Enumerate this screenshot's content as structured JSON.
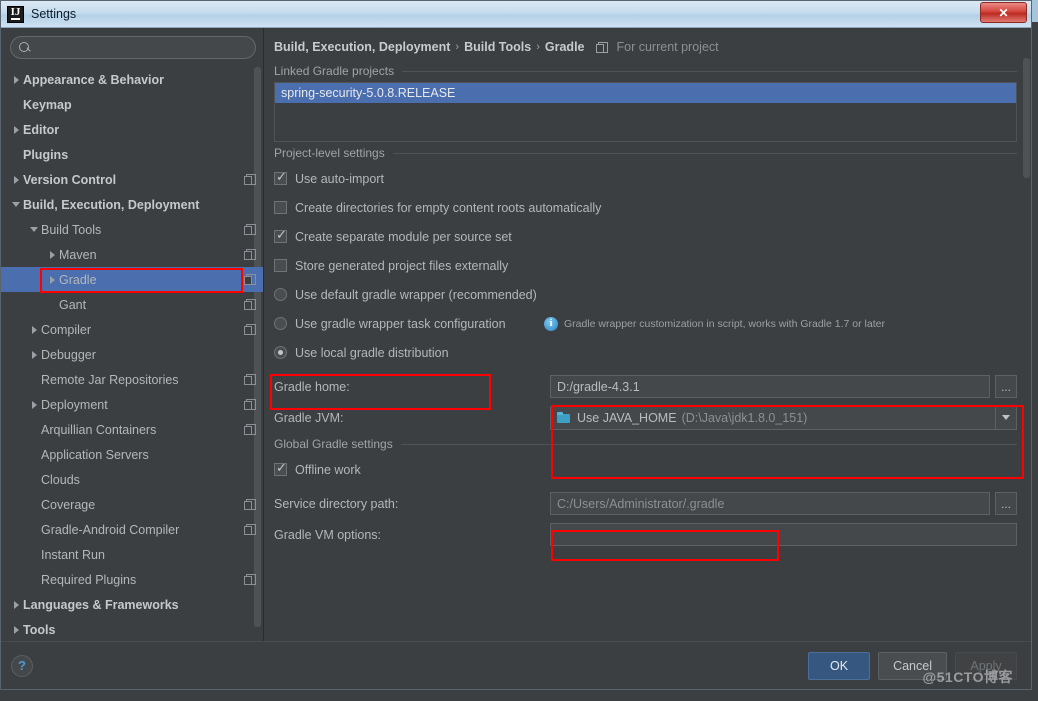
{
  "window": {
    "title": "Settings",
    "logo_text": "IJ",
    "close_label": "✕"
  },
  "search": {
    "value": "",
    "placeholder": ""
  },
  "sidebar": {
    "items": [
      {
        "label": "Appearance & Behavior",
        "indent": 0,
        "arrow": "right",
        "bold": true,
        "copy": false,
        "selected": false
      },
      {
        "label": "Keymap",
        "indent": 0,
        "arrow": "none",
        "bold": true,
        "copy": false,
        "selected": false
      },
      {
        "label": "Editor",
        "indent": 0,
        "arrow": "right",
        "bold": true,
        "copy": false,
        "selected": false
      },
      {
        "label": "Plugins",
        "indent": 0,
        "arrow": "none",
        "bold": true,
        "copy": false,
        "selected": false
      },
      {
        "label": "Version Control",
        "indent": 0,
        "arrow": "right",
        "bold": true,
        "copy": true,
        "selected": false
      },
      {
        "label": "Build, Execution, Deployment",
        "indent": 0,
        "arrow": "down",
        "bold": true,
        "copy": false,
        "selected": false
      },
      {
        "label": "Build Tools",
        "indent": 1,
        "arrow": "down",
        "bold": false,
        "copy": true,
        "selected": false
      },
      {
        "label": "Maven",
        "indent": 2,
        "arrow": "right",
        "bold": false,
        "copy": true,
        "selected": false
      },
      {
        "label": "Gradle",
        "indent": 2,
        "arrow": "right",
        "bold": false,
        "copy": true,
        "selected": true
      },
      {
        "label": "Gant",
        "indent": 2,
        "arrow": "none",
        "bold": false,
        "copy": true,
        "selected": false
      },
      {
        "label": "Compiler",
        "indent": 1,
        "arrow": "right",
        "bold": false,
        "copy": true,
        "selected": false
      },
      {
        "label": "Debugger",
        "indent": 1,
        "arrow": "right",
        "bold": false,
        "copy": false,
        "selected": false
      },
      {
        "label": "Remote Jar Repositories",
        "indent": 1,
        "arrow": "none",
        "bold": false,
        "copy": true,
        "selected": false
      },
      {
        "label": "Deployment",
        "indent": 1,
        "arrow": "right",
        "bold": false,
        "copy": true,
        "selected": false
      },
      {
        "label": "Arquillian Containers",
        "indent": 1,
        "arrow": "none",
        "bold": false,
        "copy": true,
        "selected": false
      },
      {
        "label": "Application Servers",
        "indent": 1,
        "arrow": "none",
        "bold": false,
        "copy": false,
        "selected": false
      },
      {
        "label": "Clouds",
        "indent": 1,
        "arrow": "none",
        "bold": false,
        "copy": false,
        "selected": false
      },
      {
        "label": "Coverage",
        "indent": 1,
        "arrow": "none",
        "bold": false,
        "copy": true,
        "selected": false
      },
      {
        "label": "Gradle-Android Compiler",
        "indent": 1,
        "arrow": "none",
        "bold": false,
        "copy": true,
        "selected": false
      },
      {
        "label": "Instant Run",
        "indent": 1,
        "arrow": "none",
        "bold": false,
        "copy": false,
        "selected": false
      },
      {
        "label": "Required Plugins",
        "indent": 1,
        "arrow": "none",
        "bold": false,
        "copy": true,
        "selected": false
      },
      {
        "label": "Languages & Frameworks",
        "indent": 0,
        "arrow": "right",
        "bold": true,
        "copy": false,
        "selected": false
      },
      {
        "label": "Tools",
        "indent": 0,
        "arrow": "right",
        "bold": true,
        "copy": false,
        "selected": false
      }
    ]
  },
  "breadcrumb": {
    "part1": "Build, Execution, Deployment",
    "sep1": "›",
    "part2": "Build Tools",
    "sep2": "›",
    "part3": "Gradle",
    "note": "For current project"
  },
  "linked_projects": {
    "group_title": "Linked Gradle projects",
    "items": [
      {
        "label": "spring-security-5.0.8.RELEASE",
        "selected": true
      }
    ]
  },
  "project_level": {
    "group_title": "Project-level settings",
    "checkboxes": [
      {
        "label": "Use auto-import",
        "checked": true
      },
      {
        "label": "Create directories for empty content roots automatically",
        "checked": false
      },
      {
        "label": "Create separate module per source set",
        "checked": true
      },
      {
        "label": "Store generated project files externally",
        "checked": false
      }
    ],
    "radios": [
      {
        "label": "Use default gradle wrapper (recommended)",
        "checked": false
      },
      {
        "label": "Use gradle wrapper task configuration",
        "checked": false
      },
      {
        "label": "Use local gradle distribution",
        "checked": true
      }
    ],
    "wrapper_note": "Gradle wrapper customization in script, works with Gradle 1.7 or later",
    "gradle_home": {
      "label": "Gradle home:",
      "value": "D:/gradle-4.3.1",
      "browse_label": "..."
    },
    "gradle_jvm": {
      "label": "Gradle JVM:",
      "value": "Use JAVA_HOME",
      "value_detail": "(D:\\Java\\jdk1.8.0_151)"
    }
  },
  "global_settings": {
    "group_title": "Global Gradle settings",
    "offline": {
      "label": "Offline work",
      "checked": true
    },
    "service_dir": {
      "label": "Service directory path:",
      "value": "C:/Users/Administrator/.gradle",
      "browse_label": "..."
    },
    "vm_options": {
      "label": "Gradle VM options:",
      "value": ""
    }
  },
  "footer": {
    "help_label": "?",
    "ok_label": "OK",
    "cancel_label": "Cancel",
    "apply_label": "Apply",
    "watermark": "@51CTO博客"
  },
  "colors": {
    "accent_selection": "#4b6eaf",
    "primary_button": "#365880",
    "annotation": "#ff0000",
    "panel_bg": "#3c3f41"
  }
}
